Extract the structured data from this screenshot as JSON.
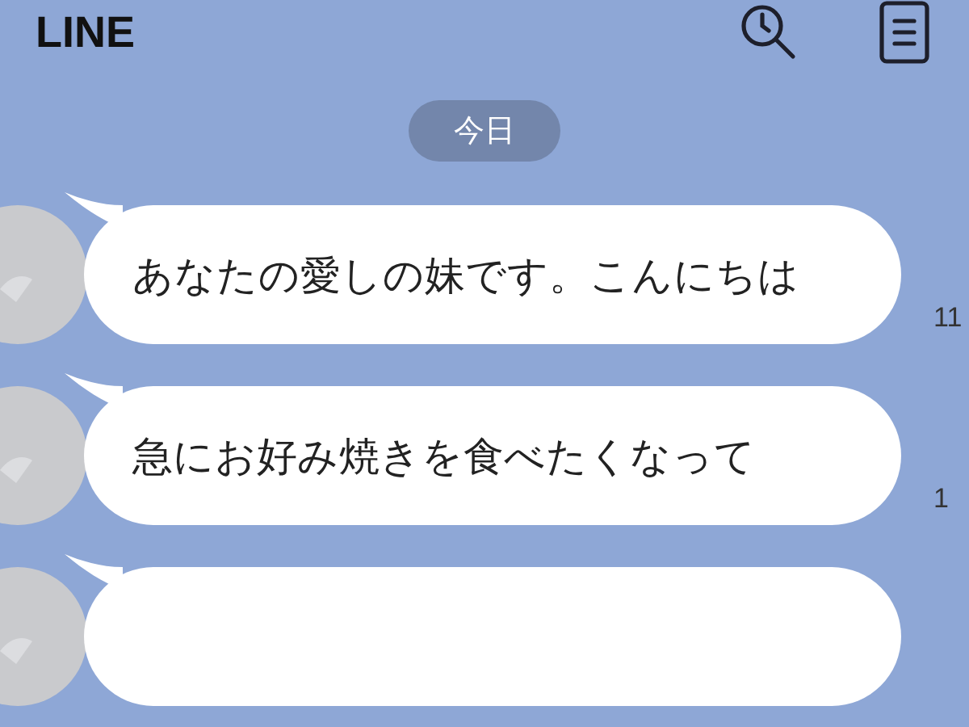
{
  "header": {
    "title": "LINE"
  },
  "date_label": "今日",
  "messages": [
    {
      "text": "あなたの愛しの妹です。こんにちは",
      "time": "11"
    },
    {
      "text": "急にお好み焼きを食べたくなって",
      "time": "1"
    }
  ],
  "more_messages_below": true
}
